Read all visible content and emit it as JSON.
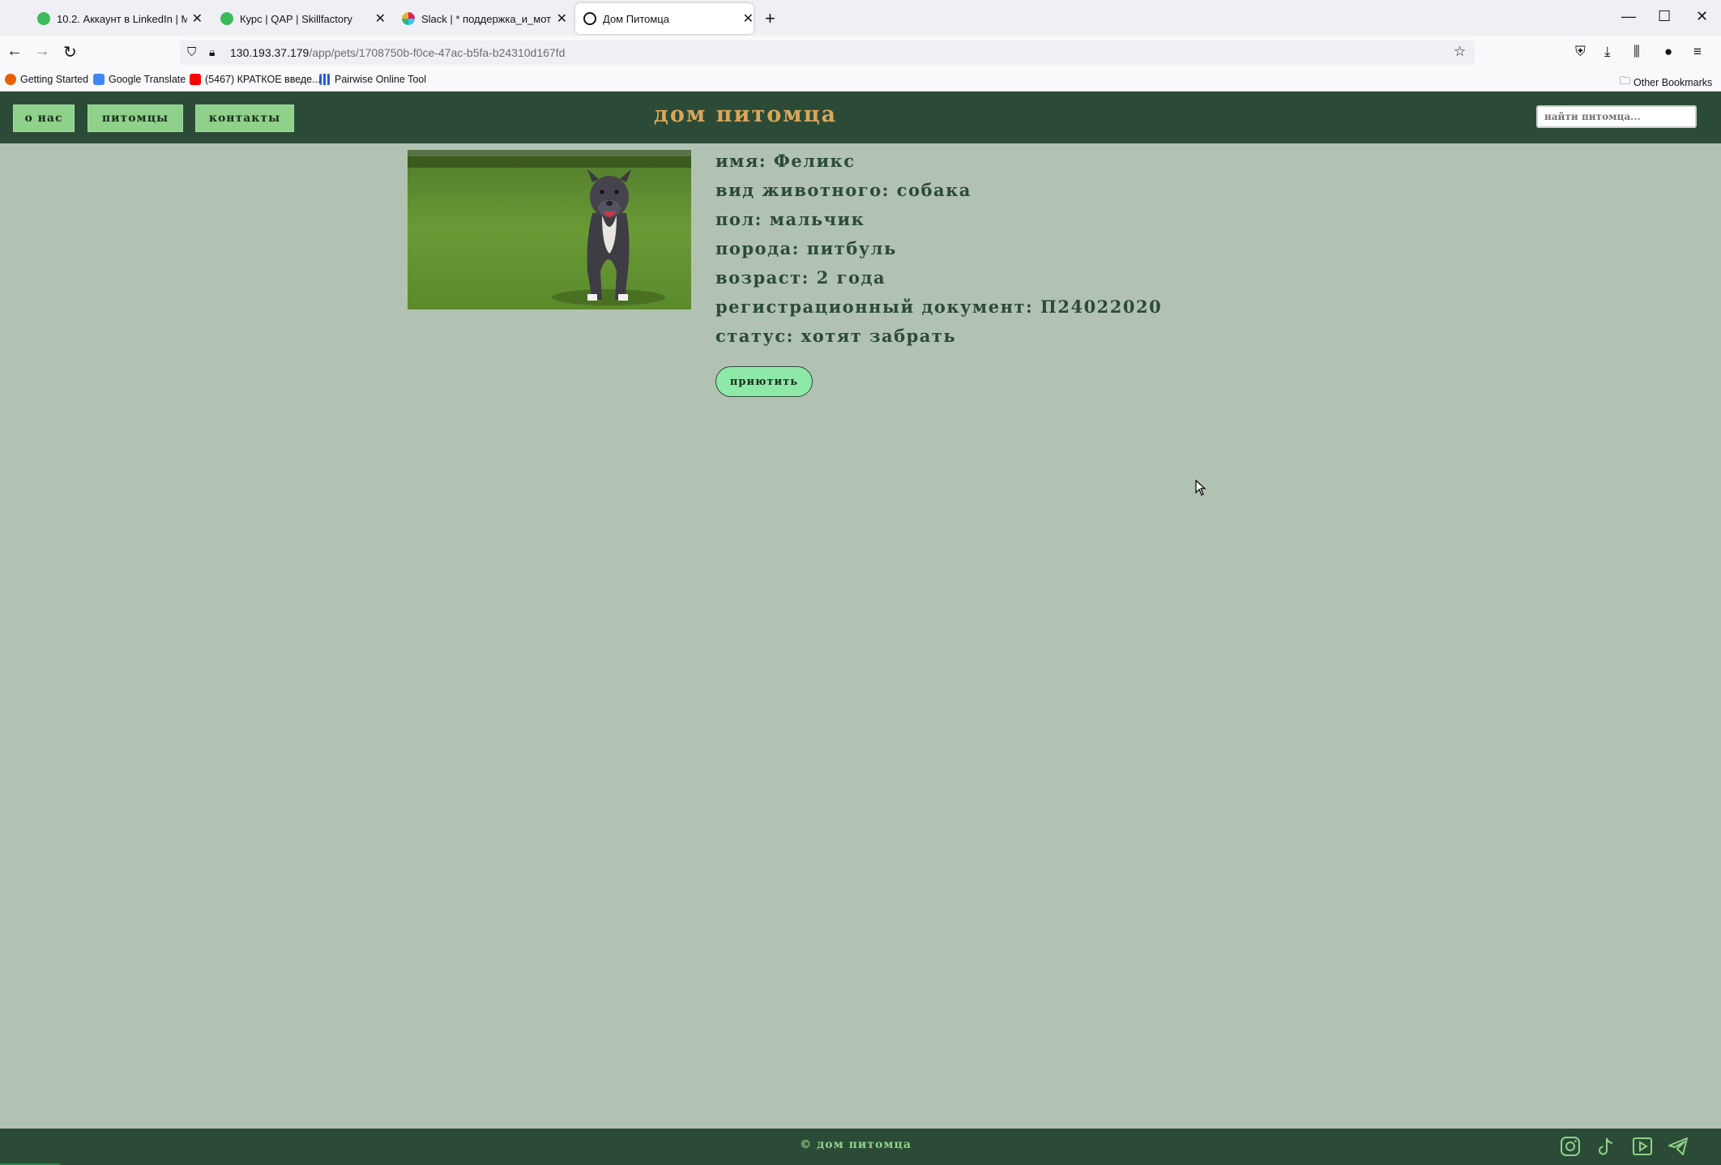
{
  "browser": {
    "tabs": [
      {
        "title": "10.2. Аккаунт в LinkedIn | Модуль",
        "favicon_color": "#3dba5c",
        "active": false
      },
      {
        "title": "Курс | QAP | Skillfactory",
        "favicon_color": "#3dba5c",
        "active": false
      },
      {
        "title": "Slack | * поддержка_и_мотивация",
        "favicon_color": "#e01e5a",
        "active": false
      },
      {
        "title": "Дом Питомца",
        "favicon_color": "#15141a",
        "active": true
      }
    ],
    "url_host": "130.193.37.179",
    "url_path": "/app/pets/1708750b-f0ce-47ac-b5fa-b24310d167fd",
    "bookmarks": [
      {
        "label": "Getting Started",
        "icon": "firefox-icon"
      },
      {
        "label": "Google Translate",
        "icon": "google-translate-icon"
      },
      {
        "label": "(5467) КРАТКОЕ введе...",
        "icon": "youtube-icon"
      },
      {
        "label": "Pairwise Online Tool",
        "icon": "grid-icon"
      }
    ],
    "other_bookmarks": "Other Bookmarks"
  },
  "site": {
    "nav": {
      "about": "о нас",
      "pets": "питомцы",
      "contacts": "контакты"
    },
    "logo": "дом питомца",
    "search_placeholder": "найти питомца..."
  },
  "pet": {
    "photo_alt": "питбуль",
    "lines": [
      "имя: Феликс",
      "вид животного: собака",
      "пол: мальчик",
      "порода: питбуль",
      "возраст: 2 года",
      "регистрационный документ: П24022020",
      "статус: хотят забрать"
    ],
    "adopt_button": "приютить"
  },
  "footer": {
    "copyright": "© дом питомца",
    "social": [
      "instagram-icon",
      "tiktok-icon",
      "youtube-icon",
      "telegram-icon"
    ]
  },
  "colors": {
    "header_bg": "#2c4b37",
    "page_bg": "#b2c2b2",
    "accent_green": "#8fd18a",
    "logo_gold": "#d9a65a",
    "button_mint": "#8ee8a8"
  }
}
